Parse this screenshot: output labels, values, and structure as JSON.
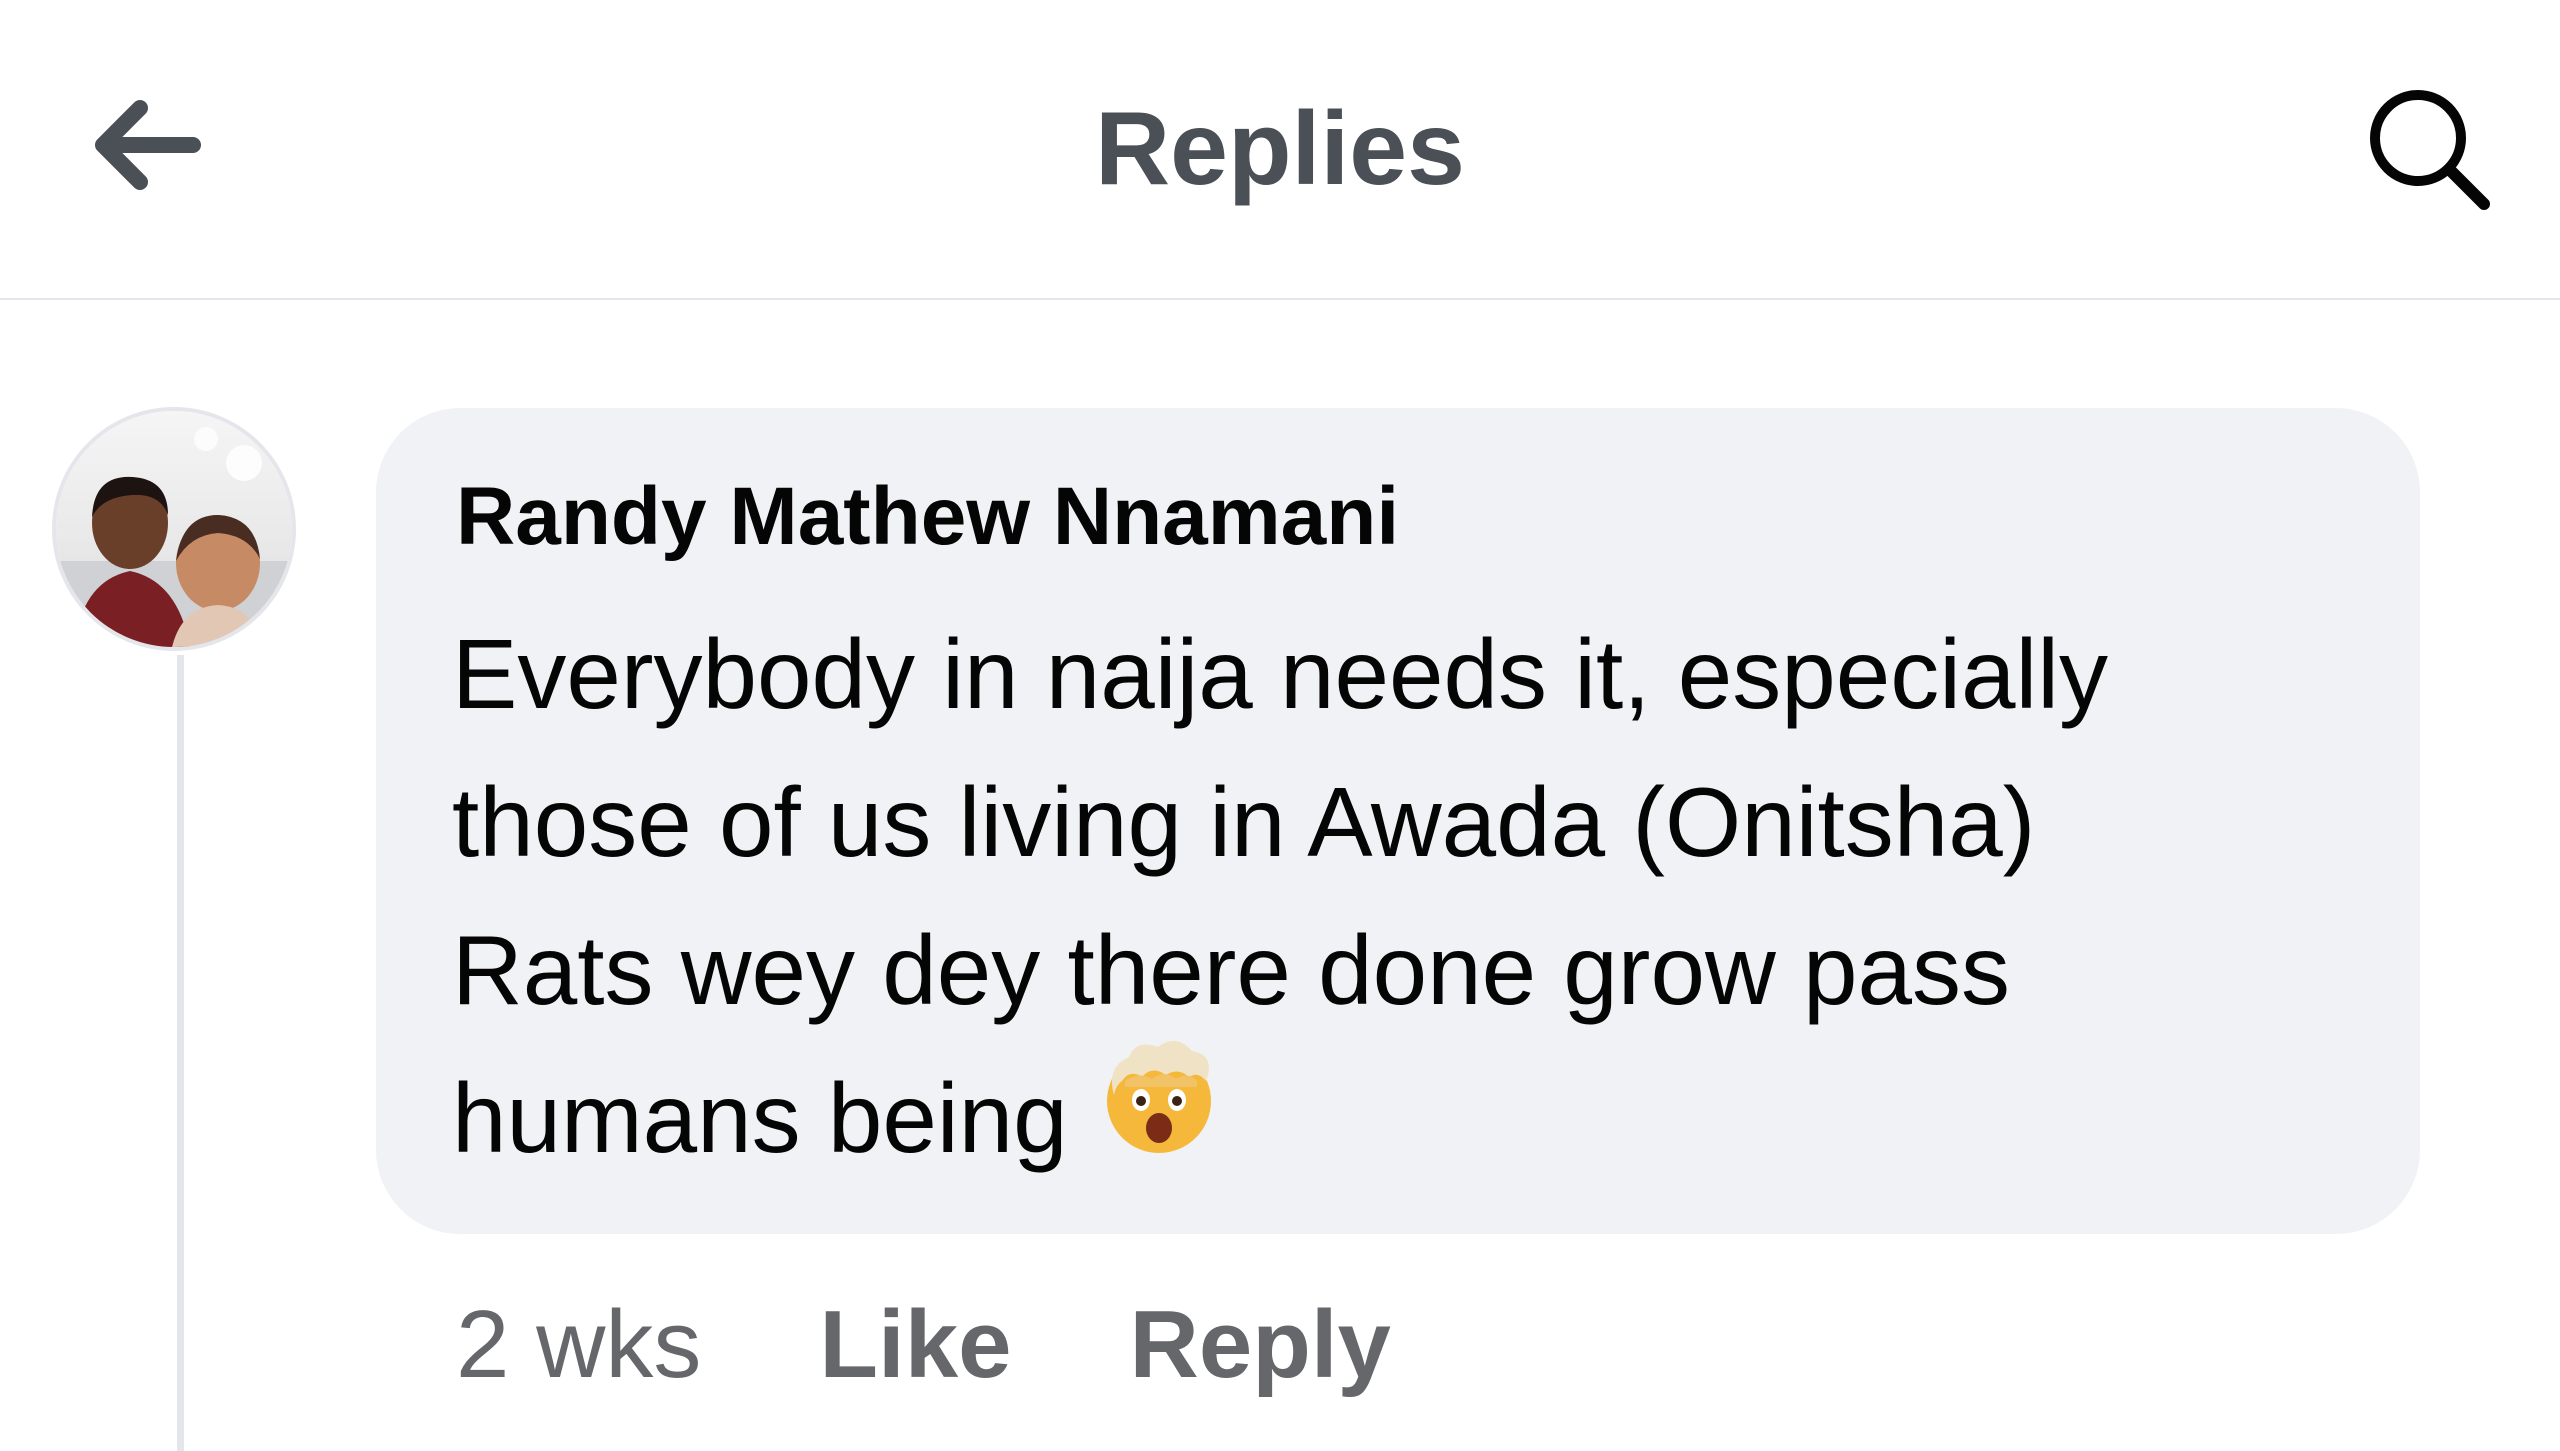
{
  "header": {
    "title": "Replies",
    "back_icon": "back-arrow-icon",
    "search_icon": "search-icon"
  },
  "comment": {
    "author": "Randy Mathew Nnamani",
    "lines": [
      "Everybody in naija needs it, especially",
      "those of us living in Awada (Onitsha)",
      "Rats wey dey there done grow pass",
      "humans being"
    ],
    "emoji": "exploding-head-emoji",
    "time": "2 wks",
    "like_label": "Like",
    "reply_label": "Reply"
  },
  "colors": {
    "bubble": "#f0f2f5",
    "text": "#050505",
    "secondary": "#65676b",
    "header_text": "#4b4f56"
  }
}
